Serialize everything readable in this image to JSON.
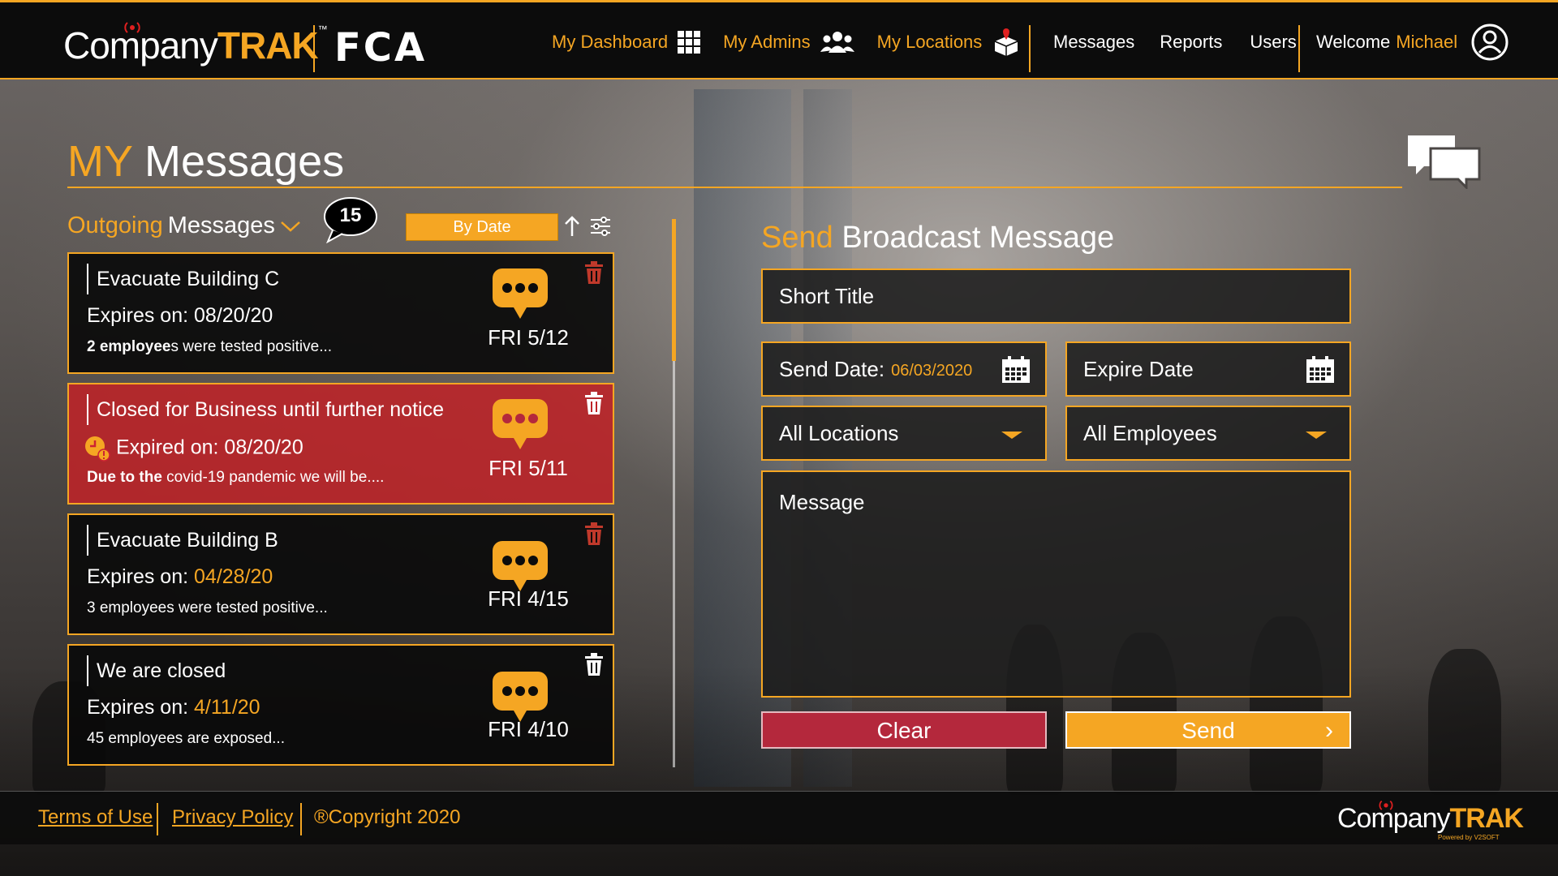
{
  "header": {
    "logo_company": "Company",
    "logo_trak": "TRAK",
    "logo_tm": "™",
    "brand": "FCA",
    "nav": [
      {
        "label": "My Dashboard",
        "icon": "grid-icon"
      },
      {
        "label": "My Admins",
        "icon": "users-icon"
      },
      {
        "label": "My Locations",
        "icon": "location-box-icon"
      }
    ],
    "links": [
      "Messages",
      "Reports",
      "Users"
    ],
    "welcome_prefix": "Welcome",
    "welcome_name": "Michael"
  },
  "page": {
    "title_accent": "MY",
    "title_rest": "Messages"
  },
  "outgoing": {
    "label_accent": "Outgoing",
    "label_rest": "Messages",
    "count": "15",
    "sort_label": "By Date"
  },
  "messages": [
    {
      "title": "Evacuate  Building C",
      "exp_label": "Expires on:",
      "exp_value": "08/20/20",
      "body_bold": "2 employee",
      "body_rest": "s were tested positive...",
      "date": "FRI 5/12",
      "alert": false
    },
    {
      "title": "Closed for Business until further notice",
      "exp_label": "Expired on:",
      "exp_value": "08/20/20",
      "body_bold": "Due to the",
      "body_rest": " covid-19 pandemic we will be....",
      "date": "FRI 5/11",
      "alert": true
    },
    {
      "title": "Evacuate  Building B",
      "exp_label": "Expires on:",
      "exp_value": "04/28/20",
      "body_bold": "",
      "body_rest": "3 employees were tested positive...",
      "date": "FRI 4/15",
      "alert": false
    },
    {
      "title": "We are closed",
      "exp_label": "Expires on:",
      "exp_value": "4/11/20",
      "body_bold": "",
      "body_rest": "45 employees are exposed...",
      "date": "FRI 4/10",
      "alert": false
    }
  ],
  "broadcast": {
    "title_accent": "Send",
    "title_rest": "Broadcast Message",
    "short_title_placeholder": "Short Title",
    "send_date_label": "Send Date:",
    "send_date_value": "06/03/2020",
    "expire_date_placeholder": "Expire Date",
    "locations_value": "All Locations",
    "employees_value": "All Employees",
    "message_placeholder": "Message",
    "clear_label": "Clear",
    "send_label": "Send"
  },
  "footer": {
    "terms": "Terms of Use",
    "privacy": "Privacy Policy",
    "copyright": "®Copyright 2020",
    "logo_company": "Company",
    "logo_trak": "TRAK",
    "powered": "Powered by V2SOFT"
  },
  "colors": {
    "accent": "#f5a623",
    "alert": "#be2328",
    "clear_button": "#b4283c",
    "trash_red": "#c0392b"
  }
}
